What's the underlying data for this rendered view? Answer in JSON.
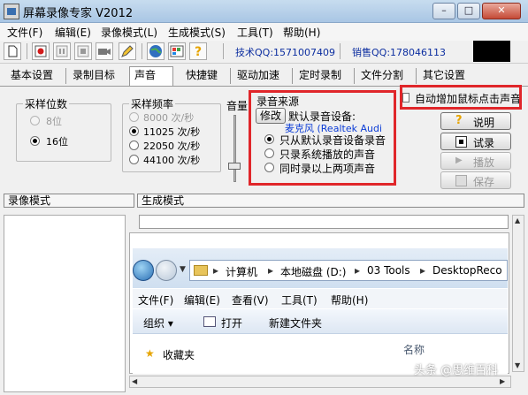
{
  "window": {
    "title": "屏幕录像专家 V2012",
    "buttons": {
      "minimize": "–",
      "restore": "□",
      "close": "✕"
    }
  },
  "menubar": [
    "文件(F)",
    "编辑(E)",
    "录像模式(L)",
    "生成模式(S)",
    "工具(T)",
    "帮助(H)"
  ],
  "toolbar": {
    "icons": [
      "new-file-icon",
      "record-icon",
      "pause-icon",
      "stop-icon",
      "camera-icon",
      "pencil-icon",
      "globe-icon",
      "palette-icon",
      "help-icon"
    ],
    "tech_qq": "技术QQ:1571007409",
    "sales_qq": "销售QQ:178046113"
  },
  "tabs": [
    "基本设置",
    "录制目标",
    "声音",
    "快捷键",
    "驱动加速",
    "定时录制",
    "文件分割",
    "其它设置"
  ],
  "active_tab": "声音",
  "sampling_bits": {
    "label": "采样位数",
    "options": [
      {
        "label": "8位",
        "selected": false,
        "disabled": true
      },
      {
        "label": "16位",
        "selected": true,
        "disabled": false
      }
    ]
  },
  "sampling_rate": {
    "label": "采样频率",
    "options": [
      {
        "label": "8000 次/秒",
        "selected": false,
        "disabled": true
      },
      {
        "label": "11025 次/秒",
        "selected": true,
        "disabled": false
      },
      {
        "label": "22050 次/秒",
        "selected": false,
        "disabled": false
      },
      {
        "label": "44100 次/秒",
        "selected": false,
        "disabled": false
      }
    ]
  },
  "volume_label": "音量",
  "audio_source": {
    "label": "录音来源",
    "modify_button": "修改",
    "default_device_label": "默认录音设备:",
    "device_name": "麦克风 (Realtek Audi",
    "options": [
      {
        "label": "只从默认录音设备录音",
        "selected": true
      },
      {
        "label": "只录系统播放的声音",
        "selected": false
      },
      {
        "label": "同时录以上两项声音",
        "selected": false
      }
    ]
  },
  "auto_click_sound": {
    "label": "自动增加鼠标点击声音",
    "checked": false
  },
  "side_buttons": {
    "help": "说明",
    "test_record": "试录",
    "play": "播放",
    "save": "保存"
  },
  "bottom": {
    "record_mode": "录像模式",
    "generate_mode": "生成模式"
  },
  "explorer": {
    "path": [
      "计算机",
      "本地磁盘 (D:)",
      "03 Tools",
      "DesktopReco"
    ],
    "menu": [
      "文件(F)",
      "编辑(E)",
      "查看(V)",
      "工具(T)",
      "帮助(H)"
    ],
    "organize": "组织 ▾",
    "open": "打开",
    "new_folder": "新建文件夹",
    "favorites": "收藏夹",
    "name_column": "名称"
  },
  "watermark": "头条 @思维百科",
  "colors": {
    "highlight_red": "#e0262a",
    "qq_blue": "#0c2ea0",
    "device_blue": "#0a3bd6"
  }
}
